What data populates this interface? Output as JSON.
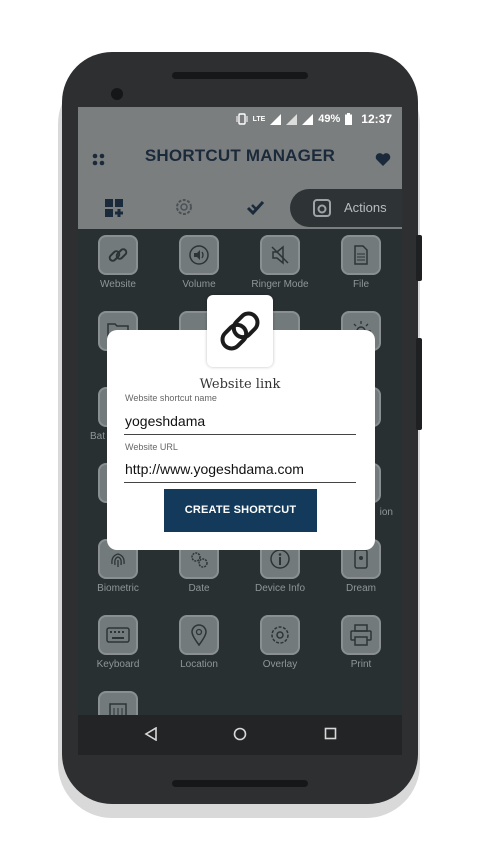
{
  "status_bar": {
    "network": "LTE",
    "battery": "49%",
    "time": "12:37"
  },
  "toolbar": {
    "title": "SHORTCUT MANAGER",
    "menu_icon": "grid-dots-icon",
    "favorite_icon": "heart-icon"
  },
  "tabs": [
    {
      "icon": "dashboard-add-icon"
    },
    {
      "icon": "gear-icon"
    },
    {
      "icon": "done-all-icon"
    },
    {
      "icon": "actions-icon",
      "label": "Actions"
    }
  ],
  "shortcut_tiles": [
    {
      "label": "Website",
      "icon": "link-icon"
    },
    {
      "label": "Volume",
      "icon": "volume-icon"
    },
    {
      "label": "Ringer Mode",
      "icon": "mute-icon"
    },
    {
      "label": "File",
      "icon": "file-icon"
    },
    {
      "label": "Bat",
      "icon": "battery-icon"
    },
    {
      "label": "",
      "icon": "sim-icon"
    },
    {
      "label": "ion",
      "icon": "location-icon"
    },
    {
      "label": "Biometric",
      "icon": "fingerprint-icon"
    },
    {
      "label": "Date",
      "icon": "date-gear-icon"
    },
    {
      "label": "Device Info",
      "icon": "info-icon"
    },
    {
      "label": "Dream",
      "icon": "dream-icon"
    },
    {
      "label": "Keyboard",
      "icon": "keyboard-icon"
    },
    {
      "label": "Location",
      "icon": "location-pin-icon"
    },
    {
      "label": "Overlay",
      "icon": "overlay-icon"
    },
    {
      "label": "Print",
      "icon": "print-icon"
    }
  ],
  "dialog": {
    "title": "Website link",
    "icon": "chain-link-icon",
    "name_label": "Website shortcut name",
    "name_value": "yogeshdama",
    "url_label": "Website URL",
    "url_value": "http://www.yogeshdama.com",
    "button_label": "CREATE SHORTCUT"
  },
  "navigation": {
    "back": "back-triangle-icon",
    "home": "home-circle-icon",
    "recents": "recents-square-icon"
  },
  "colors": {
    "primary_dark": "#133a5b",
    "toolbar": "#7b7e7f",
    "background": "#283032"
  }
}
